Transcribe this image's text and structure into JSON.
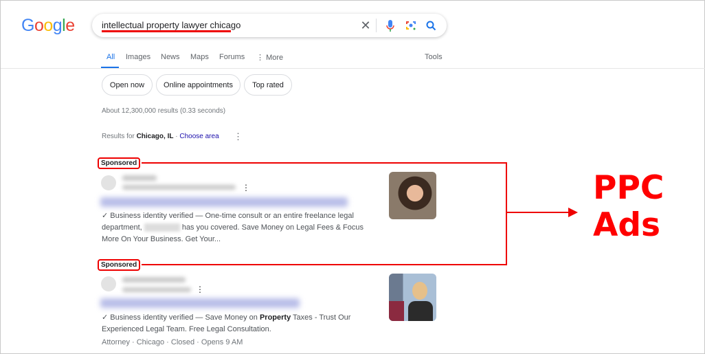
{
  "header": {
    "logo": "Google",
    "query": "intellectual property lawyer chicago"
  },
  "tabs": [
    {
      "label": "All",
      "active": true
    },
    {
      "label": "Images"
    },
    {
      "label": "News"
    },
    {
      "label": "Maps"
    },
    {
      "label": "Forums"
    },
    {
      "label": "More"
    }
  ],
  "tools_label": "Tools",
  "chips": [
    "Open now",
    "Online appointments",
    "Top rated"
  ],
  "stats": "About 12,300,000 results (0.33 seconds)",
  "location": {
    "prefix": "Results for ",
    "place": "Chicago, IL",
    "sep": " · ",
    "link": "Choose area"
  },
  "ads": [
    {
      "label": "Sponsored",
      "verified": "✓ Business identity verified",
      "desc_a": " — One-time consult or an entire freelance legal department, ",
      "desc_b": " has you covered. Save Money on Legal Fees & Focus More On Your Business. Get Your..."
    },
    {
      "label": "Sponsored",
      "verified": "✓ Business identity verified",
      "desc_a": " — Save Money on ",
      "desc_bold": "Property",
      "desc_b": " Taxes - Trust Our Experienced Legal Team. Free Legal Consultation.",
      "meta": "Attorney · Chicago · Closed · Opens 9 AM"
    }
  ],
  "annotation": {
    "line1": "PPC",
    "line2": "Ads",
    "color": "#ff0000"
  },
  "colors": {
    "accent": "#1a73e8",
    "link": "#1a0dab",
    "annotation": "#ff0000"
  }
}
